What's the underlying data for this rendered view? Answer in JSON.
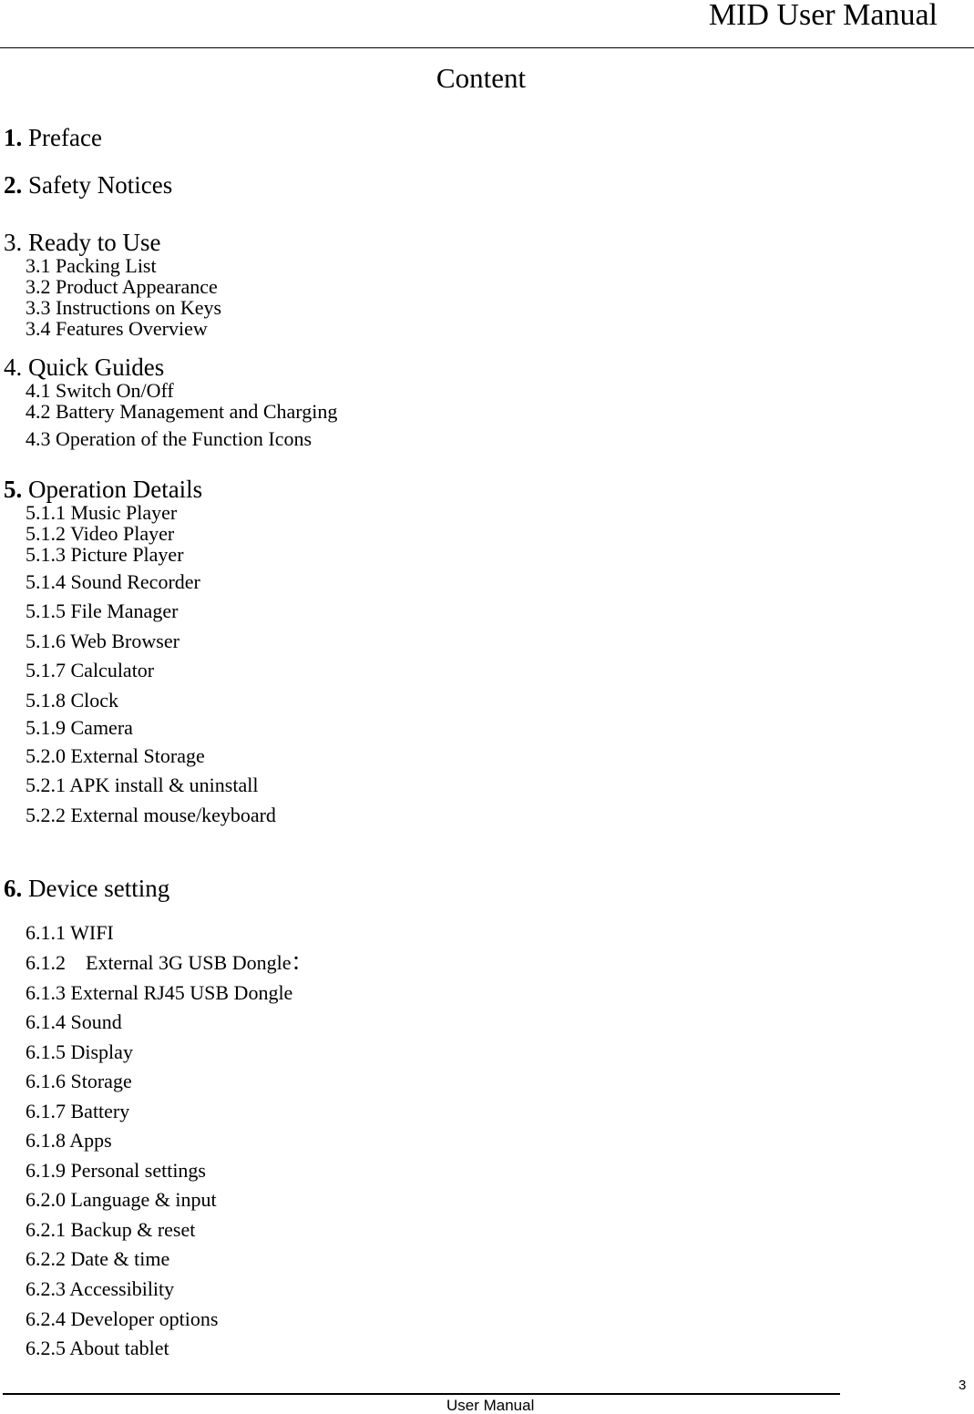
{
  "header": {
    "title": "MID User Manual"
  },
  "content_title": "Content",
  "sections": [
    {
      "num": "1.",
      "label": " Preface",
      "bold_num": true,
      "items": []
    },
    {
      "num": "2.",
      "label": " Safety Notices",
      "bold_num": true,
      "items": []
    },
    {
      "num": "3.",
      "label": " Ready to Use",
      "bold_num": false,
      "items": [
        "3.1 Packing List",
        "3.2 Product Appearance",
        "3.3 Instructions on Keys",
        "3.4 Features Overview"
      ]
    },
    {
      "num": "4.",
      "label": " Quick Guides",
      "bold_num": false,
      "items": [
        "4.1 Switch On/Off",
        "4.2 Battery Management and Charging",
        "4.3 Operation of the Function Icons"
      ]
    },
    {
      "num": "5.",
      "label": " Operation Details",
      "bold_num": true,
      "items": [
        "5.1.1 Music Player",
        "5.1.2 Video Player",
        "5.1.3 Picture Player",
        "5.1.4 Sound Recorder",
        "5.1.5 File Manager",
        "5.1.6 Web Browser",
        "5.1.7 Calculator",
        "5.1.8 Clock",
        "5.1.9 Camera",
        "5.2.0 External Storage",
        "5.2.1 APK install & uninstall",
        "5.2.2 External mouse/keyboard"
      ]
    },
    {
      "num": "6.",
      "label": " Device setting",
      "bold_num": true,
      "items": [
        "6.1.1 WIFI",
        "6.1.2    External 3G USB Dongle：",
        "6.1.3 External RJ45 USB Dongle",
        "6.1.4 Sound",
        "6.1.5 Display",
        "6.1.6 Storage",
        "6.1.7 Battery",
        "6.1.8 Apps",
        "6.1.9 Personal settings",
        "6.2.0 Language & input",
        "6.2.1 Backup & reset",
        "6.2.2 Date & time",
        "6.2.3 Accessibility",
        "6.2.4 Developer options",
        "6.2.5 About tablet"
      ]
    }
  ],
  "footer": {
    "text": "User Manual",
    "page_number": "3"
  }
}
